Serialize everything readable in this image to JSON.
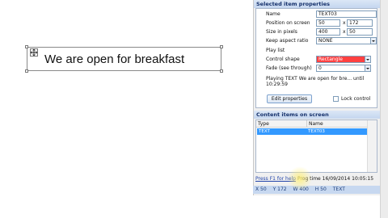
{
  "canvas": {
    "text_item": "We are open for breakfast"
  },
  "properties": {
    "header": "Selected item properties",
    "name_label": "Name",
    "name_value": "TEXT03",
    "position_label": "Position on screen",
    "position_x": "50",
    "position_sep": "x",
    "position_y": "172",
    "size_label": "Size in pixels",
    "size_w": "400",
    "size_sep": "x",
    "size_h": "50",
    "aspect_label": "Keep aspect ratio",
    "aspect_value": "NONE",
    "playlist_label": "Play list",
    "control_shape_label": "Control shape",
    "control_shape_value": "Rectangle",
    "fade_label": "Fade (see through)",
    "fade_value": "0",
    "playing_text": "Playing TEXT We are open for bre... until 10:29:59",
    "edit_button": "Edit properties",
    "lock_label": "Lock control"
  },
  "content": {
    "header": "Content items on screen",
    "columns": [
      "Type",
      "Name"
    ],
    "rows": [
      {
        "type": "TEXT",
        "name": "TEXT03"
      }
    ]
  },
  "status": {
    "help_link": "Press F1 for help",
    "prog_time": "Prog time 16/09/2014 10:05:15"
  },
  "coords": {
    "x": "X 50",
    "y": "Y 172",
    "w": "W 400",
    "h": "H 50",
    "type": "TEXT"
  }
}
